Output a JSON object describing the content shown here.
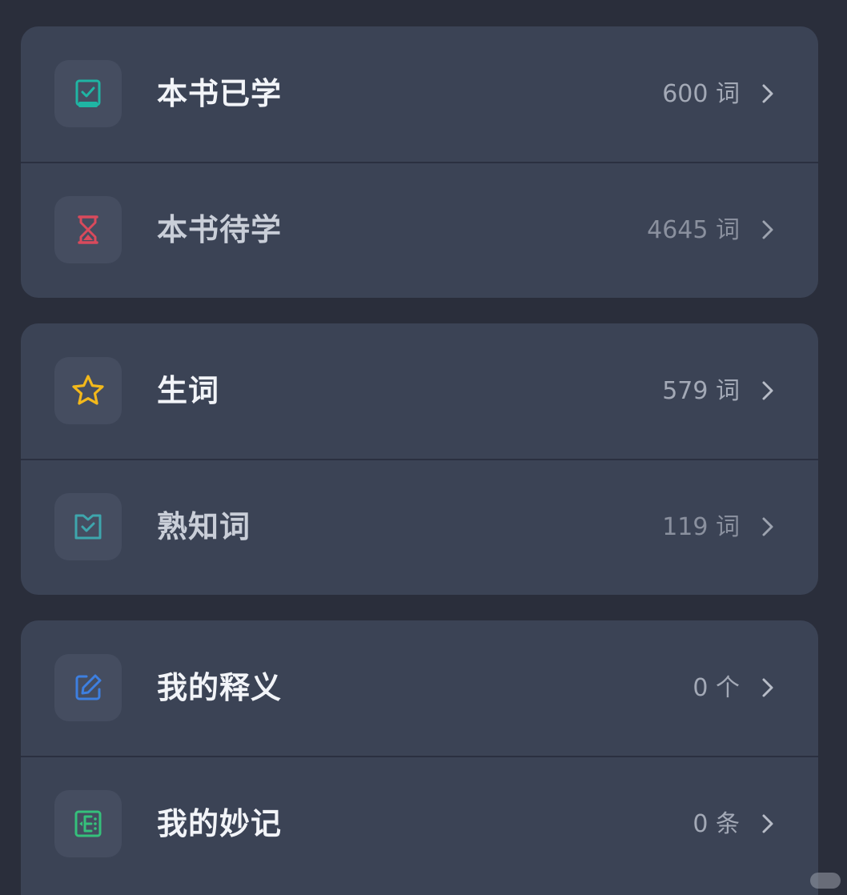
{
  "groups": [
    {
      "rows": [
        {
          "label": "本书已学",
          "count": "600 词",
          "icon": "book-check-icon",
          "icon_color": "#1fb5a4"
        },
        {
          "label": "本书待学",
          "count": "4645 词",
          "icon": "hourglass-icon",
          "icon_color": "#d94a5c"
        }
      ]
    },
    {
      "rows": [
        {
          "label": "生词",
          "count": "579 词",
          "icon": "star-icon",
          "icon_color": "#f2b81b"
        },
        {
          "label": "熟知词",
          "count": "119 词",
          "icon": "known-check-icon",
          "icon_color": "#3ea6ad"
        }
      ]
    },
    {
      "rows": [
        {
          "label": "我的释义",
          "count": "0 个",
          "icon": "edit-icon",
          "icon_color": "#3d7fe0"
        },
        {
          "label": "我的妙记",
          "count": "0 条",
          "icon": "note-icon",
          "icon_color": "#35c07b"
        }
      ]
    }
  ],
  "colors": {
    "background": "#2a2e3b",
    "card": "#3b4355",
    "icon_tile": "#454d60",
    "label": "#f2f4f8",
    "count": "#a3a9b6"
  }
}
